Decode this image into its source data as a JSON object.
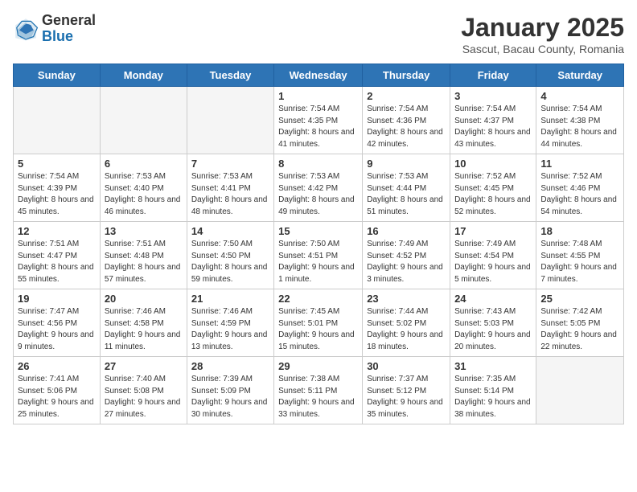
{
  "logo": {
    "general": "General",
    "blue": "Blue"
  },
  "title": "January 2025",
  "subtitle": "Sascut, Bacau County, Romania",
  "days_of_week": [
    "Sunday",
    "Monday",
    "Tuesday",
    "Wednesday",
    "Thursday",
    "Friday",
    "Saturday"
  ],
  "weeks": [
    [
      {
        "day": "",
        "info": ""
      },
      {
        "day": "",
        "info": ""
      },
      {
        "day": "",
        "info": ""
      },
      {
        "day": "1",
        "info": "Sunrise: 7:54 AM\nSunset: 4:35 PM\nDaylight: 8 hours and 41 minutes."
      },
      {
        "day": "2",
        "info": "Sunrise: 7:54 AM\nSunset: 4:36 PM\nDaylight: 8 hours and 42 minutes."
      },
      {
        "day": "3",
        "info": "Sunrise: 7:54 AM\nSunset: 4:37 PM\nDaylight: 8 hours and 43 minutes."
      },
      {
        "day": "4",
        "info": "Sunrise: 7:54 AM\nSunset: 4:38 PM\nDaylight: 8 hours and 44 minutes."
      }
    ],
    [
      {
        "day": "5",
        "info": "Sunrise: 7:54 AM\nSunset: 4:39 PM\nDaylight: 8 hours and 45 minutes."
      },
      {
        "day": "6",
        "info": "Sunrise: 7:53 AM\nSunset: 4:40 PM\nDaylight: 8 hours and 46 minutes."
      },
      {
        "day": "7",
        "info": "Sunrise: 7:53 AM\nSunset: 4:41 PM\nDaylight: 8 hours and 48 minutes."
      },
      {
        "day": "8",
        "info": "Sunrise: 7:53 AM\nSunset: 4:42 PM\nDaylight: 8 hours and 49 minutes."
      },
      {
        "day": "9",
        "info": "Sunrise: 7:53 AM\nSunset: 4:44 PM\nDaylight: 8 hours and 51 minutes."
      },
      {
        "day": "10",
        "info": "Sunrise: 7:52 AM\nSunset: 4:45 PM\nDaylight: 8 hours and 52 minutes."
      },
      {
        "day": "11",
        "info": "Sunrise: 7:52 AM\nSunset: 4:46 PM\nDaylight: 8 hours and 54 minutes."
      }
    ],
    [
      {
        "day": "12",
        "info": "Sunrise: 7:51 AM\nSunset: 4:47 PM\nDaylight: 8 hours and 55 minutes."
      },
      {
        "day": "13",
        "info": "Sunrise: 7:51 AM\nSunset: 4:48 PM\nDaylight: 8 hours and 57 minutes."
      },
      {
        "day": "14",
        "info": "Sunrise: 7:50 AM\nSunset: 4:50 PM\nDaylight: 8 hours and 59 minutes."
      },
      {
        "day": "15",
        "info": "Sunrise: 7:50 AM\nSunset: 4:51 PM\nDaylight: 9 hours and 1 minute."
      },
      {
        "day": "16",
        "info": "Sunrise: 7:49 AM\nSunset: 4:52 PM\nDaylight: 9 hours and 3 minutes."
      },
      {
        "day": "17",
        "info": "Sunrise: 7:49 AM\nSunset: 4:54 PM\nDaylight: 9 hours and 5 minutes."
      },
      {
        "day": "18",
        "info": "Sunrise: 7:48 AM\nSunset: 4:55 PM\nDaylight: 9 hours and 7 minutes."
      }
    ],
    [
      {
        "day": "19",
        "info": "Sunrise: 7:47 AM\nSunset: 4:56 PM\nDaylight: 9 hours and 9 minutes."
      },
      {
        "day": "20",
        "info": "Sunrise: 7:46 AM\nSunset: 4:58 PM\nDaylight: 9 hours and 11 minutes."
      },
      {
        "day": "21",
        "info": "Sunrise: 7:46 AM\nSunset: 4:59 PM\nDaylight: 9 hours and 13 minutes."
      },
      {
        "day": "22",
        "info": "Sunrise: 7:45 AM\nSunset: 5:01 PM\nDaylight: 9 hours and 15 minutes."
      },
      {
        "day": "23",
        "info": "Sunrise: 7:44 AM\nSunset: 5:02 PM\nDaylight: 9 hours and 18 minutes."
      },
      {
        "day": "24",
        "info": "Sunrise: 7:43 AM\nSunset: 5:03 PM\nDaylight: 9 hours and 20 minutes."
      },
      {
        "day": "25",
        "info": "Sunrise: 7:42 AM\nSunset: 5:05 PM\nDaylight: 9 hours and 22 minutes."
      }
    ],
    [
      {
        "day": "26",
        "info": "Sunrise: 7:41 AM\nSunset: 5:06 PM\nDaylight: 9 hours and 25 minutes."
      },
      {
        "day": "27",
        "info": "Sunrise: 7:40 AM\nSunset: 5:08 PM\nDaylight: 9 hours and 27 minutes."
      },
      {
        "day": "28",
        "info": "Sunrise: 7:39 AM\nSunset: 5:09 PM\nDaylight: 9 hours and 30 minutes."
      },
      {
        "day": "29",
        "info": "Sunrise: 7:38 AM\nSunset: 5:11 PM\nDaylight: 9 hours and 33 minutes."
      },
      {
        "day": "30",
        "info": "Sunrise: 7:37 AM\nSunset: 5:12 PM\nDaylight: 9 hours and 35 minutes."
      },
      {
        "day": "31",
        "info": "Sunrise: 7:35 AM\nSunset: 5:14 PM\nDaylight: 9 hours and 38 minutes."
      },
      {
        "day": "",
        "info": ""
      }
    ]
  ]
}
